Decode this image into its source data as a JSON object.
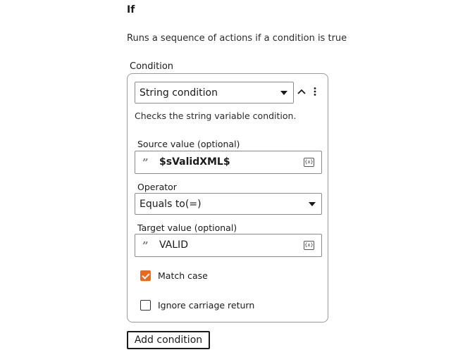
{
  "action": {
    "title": "If",
    "description": "Runs a sequence of actions if a condition is true"
  },
  "condition": {
    "section_label": "Condition",
    "type_selected": "String condition",
    "description": "Checks the string variable condition.",
    "source": {
      "label": "Source value (optional)",
      "value": "$sValidXML$",
      "icon": "quote-icon",
      "var_icon": "{x}"
    },
    "operator": {
      "label": "Operator",
      "selected": "Equals to(=)"
    },
    "target": {
      "label": "Target value (optional)",
      "value": "VALID",
      "icon": "quote-icon",
      "var_icon": "{x}"
    },
    "match_case": {
      "label": "Match case",
      "checked": true
    },
    "ignore_cr": {
      "label": "Ignore carriage return",
      "checked": false
    }
  },
  "buttons": {
    "add_condition": "Add condition"
  },
  "colors": {
    "accent": "#e86a1f",
    "border": "#8a8a8a"
  }
}
